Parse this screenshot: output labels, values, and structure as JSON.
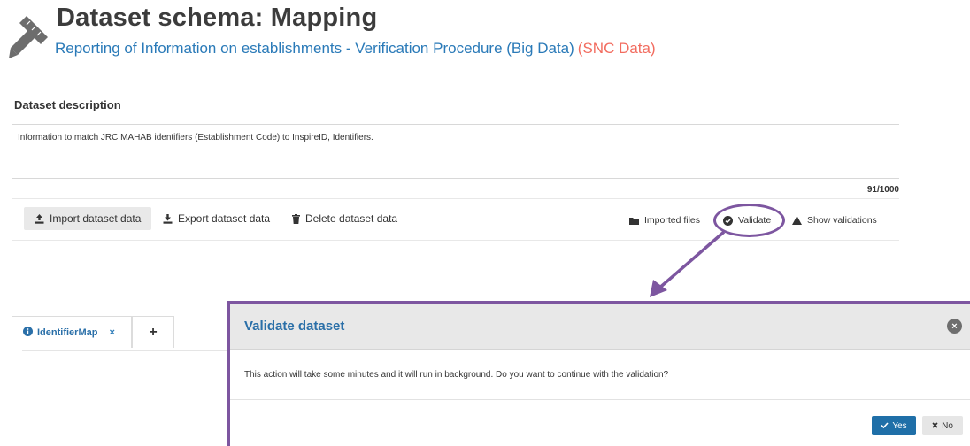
{
  "header": {
    "title": "Dataset schema: Mapping",
    "dataflow_name": "Reporting of Information on establishments - Verification Procedure (Big Data)",
    "dataflow_tag": "(SNC Data)",
    "icon": "pencil-ruler-icon"
  },
  "description": {
    "heading": "Dataset description",
    "text": "Information to match JRC MAHAB identifiers (Establishment Code) to InspireID, Identifiers.",
    "counter": "91/1000"
  },
  "toolbar": {
    "import_label": "Import dataset data",
    "export_label": "Export dataset data",
    "delete_label": "Delete dataset data",
    "imported_files_label": "Imported files",
    "validate_label": "Validate",
    "show_validations_label": "Show validations"
  },
  "tabs": {
    "active_label": "IdentifierMap",
    "close_glyph": "×",
    "add_glyph": "+"
  },
  "dialog": {
    "title": "Validate dataset",
    "close_glyph": "×",
    "message": "This action will take some minutes and it will run in background. Do you want to continue with the validation?",
    "yes_label": "Yes",
    "no_label": "No"
  },
  "colors": {
    "brand_blue": "#2a6fa8",
    "link_blue": "#2a7ab8",
    "tag_red": "#f26c5f",
    "annotation_purple": "#7d56a0"
  }
}
